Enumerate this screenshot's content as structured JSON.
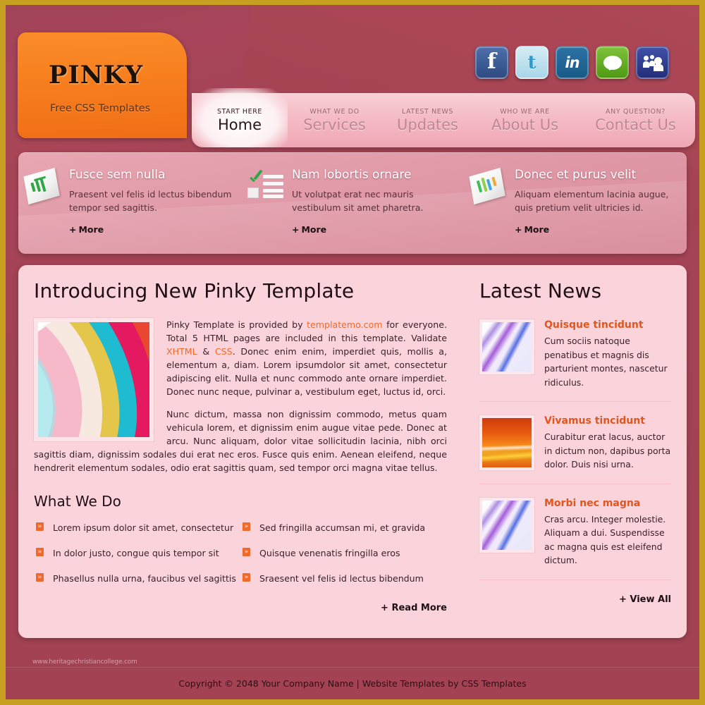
{
  "brand": {
    "title": "PINKY",
    "tagline": "Free CSS Templates"
  },
  "social": [
    {
      "name": "facebook",
      "glyph": "f"
    },
    {
      "name": "twitter",
      "glyph": "t"
    },
    {
      "name": "linkedin",
      "glyph": "in"
    },
    {
      "name": "chat",
      "glyph": ""
    },
    {
      "name": "myspace",
      "glyph": ""
    }
  ],
  "nav": [
    {
      "kicker": "START HERE",
      "label": "Home",
      "active": true
    },
    {
      "kicker": "WHAT WE DO",
      "label": "Services",
      "active": false
    },
    {
      "kicker": "LATEST NEWS",
      "label": "Updates",
      "active": false
    },
    {
      "kicker": "WHO WE ARE",
      "label": "About Us",
      "active": false
    },
    {
      "kicker": "ANY QUESTION?",
      "label": "Contact Us",
      "active": false
    }
  ],
  "features": [
    {
      "icon": "bar-chart-document-icon",
      "title": "Fusce sem nulla",
      "text": "Praesent vel felis id lectus bibendum tempor sed sagittis.",
      "more_label": "More"
    },
    {
      "icon": "checklist-icon",
      "title": "Nam lobortis ornare",
      "text": "Ut volutpat erat nec mauris vestibulum sit amet pharetra.",
      "more_label": "More"
    },
    {
      "icon": "color-chart-document-icon",
      "title": "Donec et purus velit",
      "text": "Aliquam elementum lacinia augue, quis pretium velit ultricies id.",
      "more_label": "More"
    }
  ],
  "main": {
    "title": "Introducing New Pinky Template",
    "image_alt": "colorful abstract ribbons",
    "paragraph1_a": "Pinky Template is provided by ",
    "link_templatemo": "templatemo.com",
    "paragraph1_b": " for everyone. Total 5 HTML pages are included in this template. Validate ",
    "link_xhtml": "XHTML",
    "paragraph1_c": " & ",
    "link_css": "CSS",
    "paragraph1_d": ". Donec enim enim, imperdiet quis, mollis a, elementum a, diam. Lorem ipsumdolor sit amet, consectetur adipiscing elit. Nulla et nunc commodo ante ornare imperdiet. Donec nunc neque, pulvinar a, vestibulum eget, luctus id, orci.",
    "paragraph2": "Nunc dictum, massa non dignissim commodo, metus quam vehicula lorem, et dignissim enim augue vitae pede. Donec at arcu. Nunc aliquam, dolor vitae sollicitudin lacinia, nibh orci sagittis diam, dignissim sodales dui erat nec eros. Fusce quis enim. Aenean eleifend, neque hendrerit elementum sodales, odio erat sagittis quam, sed tempor orci magna vitae tellus.",
    "what_we_do_title": "What We Do",
    "list_left": [
      "Lorem ipsum dolor sit amet, consectetur",
      "In dolor justo, congue quis tempor sit",
      "Phasellus nulla urna, faucibus vel sagittis"
    ],
    "list_right": [
      "Sed fringilla accumsan mi, et gravida",
      "Quisque venenatis fringilla eros",
      "Sraesent vel felis id lectus bibendum"
    ],
    "bullet_glyph": "»",
    "read_more_label": "Read More"
  },
  "sidebar": {
    "title": "Latest News",
    "items": [
      {
        "thumb": "violet-ribbon-thumb",
        "title": "Quisque tincidunt",
        "text": "Cum sociis natoque penatibus et magnis dis parturient montes, nascetur ridiculus."
      },
      {
        "thumb": "orange-ribbon-thumb",
        "title": "Vivamus tincidunt",
        "text": "Curabitur erat lacus, auctor in dictum non, dapibus porta dolor. Duis nisi urna."
      },
      {
        "thumb": "violet-ribbon-thumb",
        "title": "Morbi nec magna",
        "text": "Cras arcu. Integer molestie. Aliquam a dui. Suspendisse ac magna quis est eleifend dictum."
      }
    ],
    "view_all_label": "View All"
  },
  "footer": {
    "watermark": "www.heritagechristiancollege.com",
    "copyright": "Copyright © 2048 Your Company Name | Website Templates by CSS Templates"
  },
  "colors": {
    "frame_gold": "#C8A021",
    "backdrop_maroon": "#A34253",
    "logo_orange": "#F7801F",
    "nav_pink": "#F4BAC5",
    "feature_pink": "#E099A7",
    "panel_pink": "#FBD3DB",
    "accent_orange": "#EE6A2B",
    "news_heading": "#E0561F"
  },
  "plus_glyph": "+"
}
